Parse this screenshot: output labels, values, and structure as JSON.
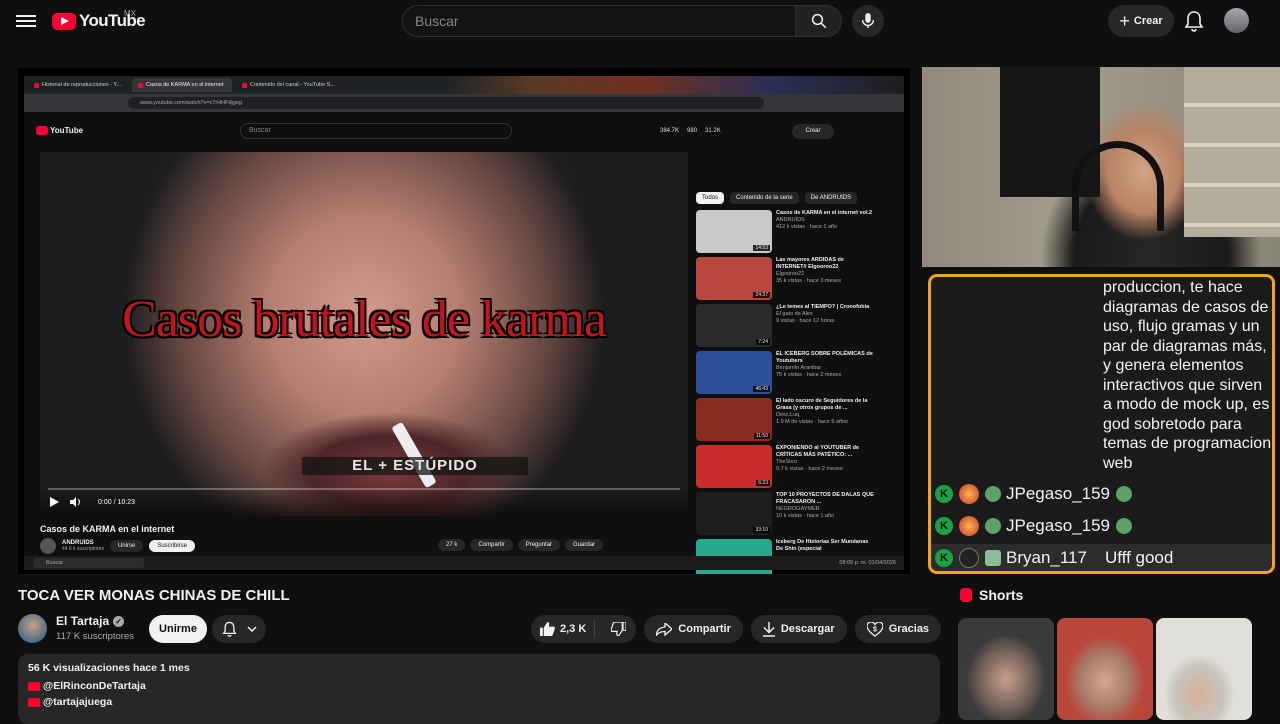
{
  "topbar": {
    "logo_text": "YouTube",
    "country": "MX",
    "search_placeholder": "Buscar",
    "create_label": "Crear"
  },
  "screen": {
    "tabs": [
      "Historial de reproducciones - Y...",
      "Casos de KARMA en el internet",
      "Contenido del canal - YouTube S..."
    ],
    "url": "www.youtube.com/watch?v=c7rHHFdjgeg",
    "inner_logo": "YouTube",
    "inner_search": "Buscar",
    "inner_stats": [
      "384.7K",
      "980",
      "31.2K"
    ],
    "inner_create": "Crear",
    "video_overlay_title": "Casos brutales de karma",
    "video_overlay_sub": "EL + ESTÚPIDO",
    "time": "0:00 / 10:23",
    "chips": [
      "Todos",
      "Contenido de la serie",
      "De ANDRUIDS"
    ],
    "recs": [
      {
        "title": "Casos de KARMA en el internet vol.2",
        "channel": "ANDRUIDS",
        "meta": "412 k vistas · hace 1 año",
        "dur": "14:53",
        "color": "#c9c9c9"
      },
      {
        "title": "Las mayores ARDIDAS de INTERNET// Elgooroo22",
        "channel": "Elgooroo22",
        "meta": "35 k vistas · hace 3 meses",
        "dur": "24:37",
        "color": "#b9473f"
      },
      {
        "title": "¿Le temes al TIEMPO? | Cronofobia",
        "channel": "El gato de Alex",
        "meta": "9 vistas · hace 12 horas",
        "dur": "7:24",
        "color": "#2a2a2a"
      },
      {
        "title": "EL ICEBERG SOBRE POLÉMICAS de Youtubers",
        "channel": "Benjamín Aranibar",
        "meta": "75 k vistas · hace 2 meses",
        "dur": "46:43",
        "color": "#2e4f9a"
      },
      {
        "title": "El lado oscuro de Seguidores de la Grasa (y otros grupos de ...",
        "channel": "Desc.Luq",
        "meta": "1.9 M de vistas · hace 5 años",
        "dur": "11:50",
        "color": "#8a2b1f"
      },
      {
        "title": "EXPONIENDO al YOUTUBER de CRÍTICAS MÁS PATÉTICO: ...",
        "channel": "TheSixxi",
        "meta": "9.7 k vistas · hace 2 meses",
        "dur": "6:23",
        "color": "#cc2b2b"
      },
      {
        "title": "TOP 10 PROYECTOS DE DALAS QUE FRACASARON ...",
        "channel": "NEGROGAYMER",
        "meta": "10 k vistas · hace 1 año",
        "dur": "33:10",
        "color": "#1e1e1e"
      },
      {
        "title": "Iceberg De Historias Ser Mundanas De Shin (especial",
        "channel": "",
        "meta": "",
        "dur": "",
        "color": "#26a88c"
      }
    ],
    "inner_video_title": "Casos de KARMA en el internet",
    "inner_channel": "ANDRUIDS",
    "inner_subs": "44.6 k suscriptores",
    "inner_join": "Unirse",
    "inner_subscribe": "Suscribirse",
    "inner_actions": [
      "27 k",
      "Compartir",
      "Preguntar",
      "Guardar"
    ],
    "taskbar_search": "Buscar",
    "clock": "08:05 p. m. 01/04/2026"
  },
  "chat": {
    "message_continued": "produccion, te hace diagramas de casos de uso, flujo gramas y un par de diagramas más, y genera elementos interactivos que sirven a modo de mock up, es god sobretodo para temas de programacion web",
    "rows": [
      {
        "name": "JPegaso_159",
        "text": "",
        "highlight": false
      },
      {
        "name": "JPegaso_159",
        "text": "",
        "highlight": false
      },
      {
        "name": "Bryan_117",
        "text": "Ufff good",
        "highlight": true
      }
    ],
    "badge_letter": "K"
  },
  "video": {
    "title": "TOCA VER MONAS CHINAS DE CHILL",
    "channel": "El Tartaja",
    "subscribers": "117 K suscriptores",
    "join_label": "Unirme",
    "likes": "2,3 K",
    "share_label": "Compartir",
    "download_label": "Descargar",
    "thanks_label": "Gracias"
  },
  "description": {
    "stats": "56 K visualizaciones  hace 1 mes",
    "links": [
      "@ElRinconDeTartaja",
      "@tartajajuega"
    ]
  },
  "shorts": {
    "heading": "Shorts"
  },
  "colors": {
    "brand_red": "#ff0033",
    "chat_border": "#f2a51a",
    "badge_green": "#1aa146"
  }
}
